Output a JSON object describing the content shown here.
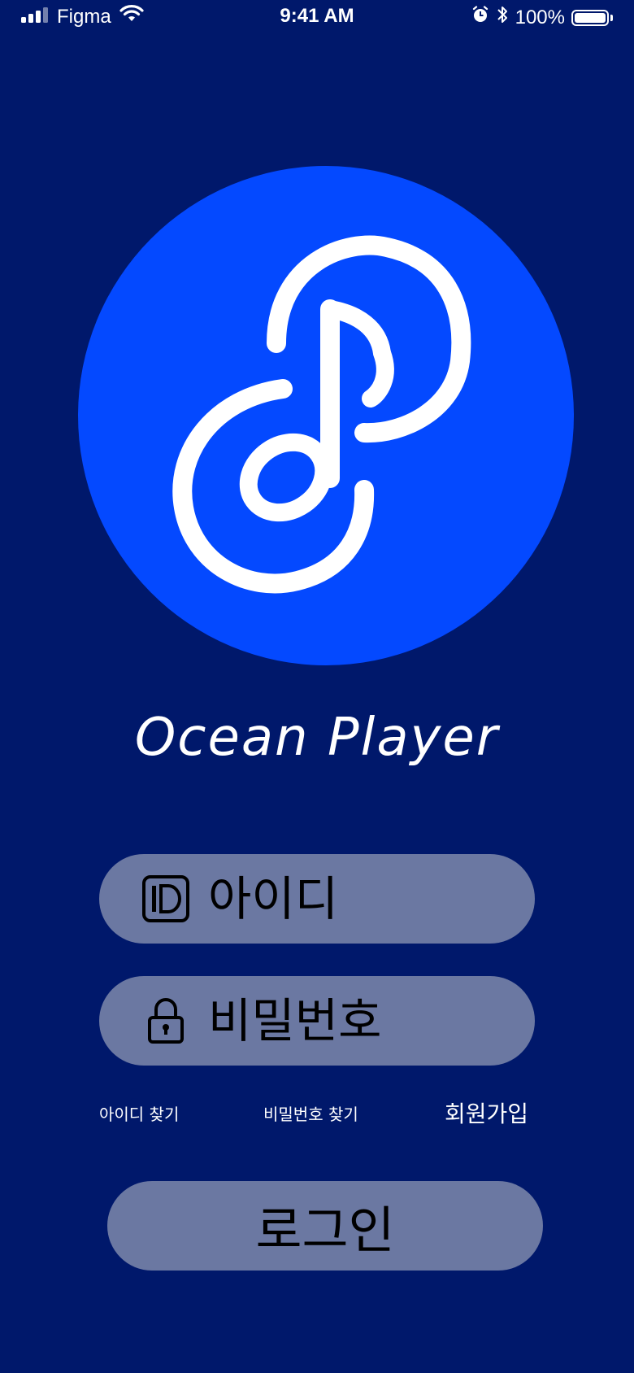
{
  "status_bar": {
    "carrier": "Figma",
    "time": "9:41 AM",
    "battery": "100%",
    "icons": [
      "signal-icon",
      "wifi-icon",
      "alarm-icon",
      "bluetooth-icon",
      "battery-icon"
    ]
  },
  "logo": {
    "icon": "music-note-logo-icon",
    "app_name": "Ocean Player"
  },
  "login_form": {
    "id_field": {
      "icon": "id-card-icon",
      "placeholder": "아이디",
      "value": ""
    },
    "password_field": {
      "icon": "lock-icon",
      "placeholder": "비밀번호",
      "value": ""
    }
  },
  "links": {
    "find_id": "아이디 찾기",
    "find_password": "비밀번호 찾기",
    "signup": "회원가입"
  },
  "login_button": {
    "label": "로그인"
  },
  "colors": {
    "background": "#00186B",
    "logo_circle": "#0449FF",
    "field_background": "#6B78A2",
    "text_light": "#FFFFFF",
    "text_dark": "#000000"
  }
}
